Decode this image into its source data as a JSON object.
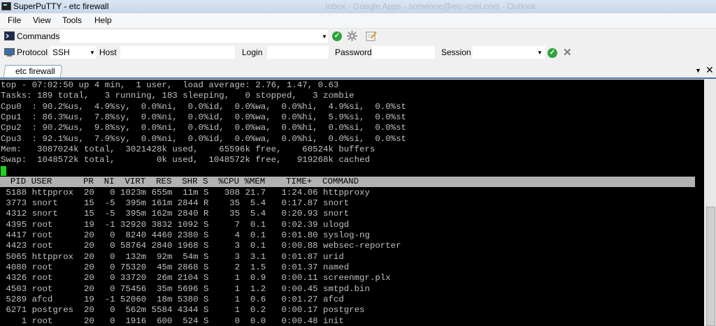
{
  "window": {
    "title": "SuperPuTTY - etc firewall",
    "background_title": "Inbox - Google Apps - someone@etc-rcmi.com - Outlook"
  },
  "menu": [
    "File",
    "View",
    "Tools",
    "Help"
  ],
  "toolbar": {
    "commands_label": "Commands",
    "protocol_label": "Protocol",
    "protocol_value": "SSH",
    "host_label": "Host",
    "login_label": "Login",
    "password_label": "Password",
    "session_label": "Session"
  },
  "tab": {
    "label": "etc firewall"
  },
  "colors": {
    "terminal_bg": "#000000",
    "terminal_fg": "#c0c0c0",
    "header_bg": "#b2b2b2",
    "cursor": "#1ed11e",
    "tab_border": "#4a76a8"
  },
  "icons": [
    "terminal-app-icon",
    "terminal-icon",
    "checkmark-icon",
    "gear-icon",
    "notepad-icon",
    "protocol-icon",
    "close-icon"
  ],
  "terminal": {
    "summary": [
      "top - 07:02:50 up 4 min,  1 user,  load average: 2.76, 1.47, 0.63",
      "Tasks: 189 total,   3 running, 183 sleeping,   0 stopped,   3 zombie",
      "Cpu0  : 90.2%us,  4.9%sy,  0.0%ni,  0.0%id,  0.0%wa,  0.0%hi,  4.9%si,  0.0%st",
      "Cpu1  : 86.3%us,  7.8%sy,  0.0%ni,  0.0%id,  0.0%wa,  0.0%hi,  5.9%si,  0.0%st",
      "Cpu2  : 90.2%us,  9.8%sy,  0.0%ni,  0.0%id,  0.0%wa,  0.0%hi,  0.0%si,  0.0%st",
      "Cpu3  : 92.1%us,  7.9%sy,  0.0%ni,  0.0%id,  0.0%wa,  0.0%hi,  0.0%si,  0.0%st",
      "Mem:   3087024k total,  3021428k used,    65596k free,    60524k buffers",
      "Swap:  1048572k total,        0k used,  1048572k free,   919268k cached"
    ],
    "header": "  PID USER      PR  NI  VIRT  RES  SHR S  %CPU %MEM    TIME+  COMMAND",
    "processes": [
      " 5188 httpprox  20   0 1023m 655m  11m S   308 21.7   1:24.06 httpproxy",
      " 3773 snort     15  -5  395m 161m 2844 R    35  5.4   0:17.87 snort",
      " 4312 snort     15  -5  395m 162m 2840 R    35  5.4   0:20.93 snort",
      " 4395 root      19  -1 32920 3832 1092 S     7  0.1   0:02.39 ulogd",
      " 4417 root      20   0  8240 4460 2380 S     4  0.1   0:01.80 syslog-ng",
      " 4423 root      20   0 58764 2840 1968 S     3  0.1   0:00.88 websec-reporter",
      " 5065 httpprox  20   0  132m  92m  54m S     3  3.1   0:01.87 urid",
      " 4080 root      20   0 75320  45m 2868 S     2  1.5   0:01.37 named",
      " 4326 root      20   0 33720  26m 2104 S     1  0.9   0:00.11 screenmgr.plx",
      " 4503 root      20   0 75456  35m 5696 S     1  1.2   0:00.45 smtpd.bin",
      " 5289 afcd      19  -1 52060  18m 5380 S     1  0.6   0:01.27 afcd",
      " 6271 postgres  20   0  562m 5584 4344 S     1  0.2   0:00.17 postgres",
      "    1 root      20   0  1916  600  524 S     0  0.0   0:00.48 init"
    ]
  }
}
